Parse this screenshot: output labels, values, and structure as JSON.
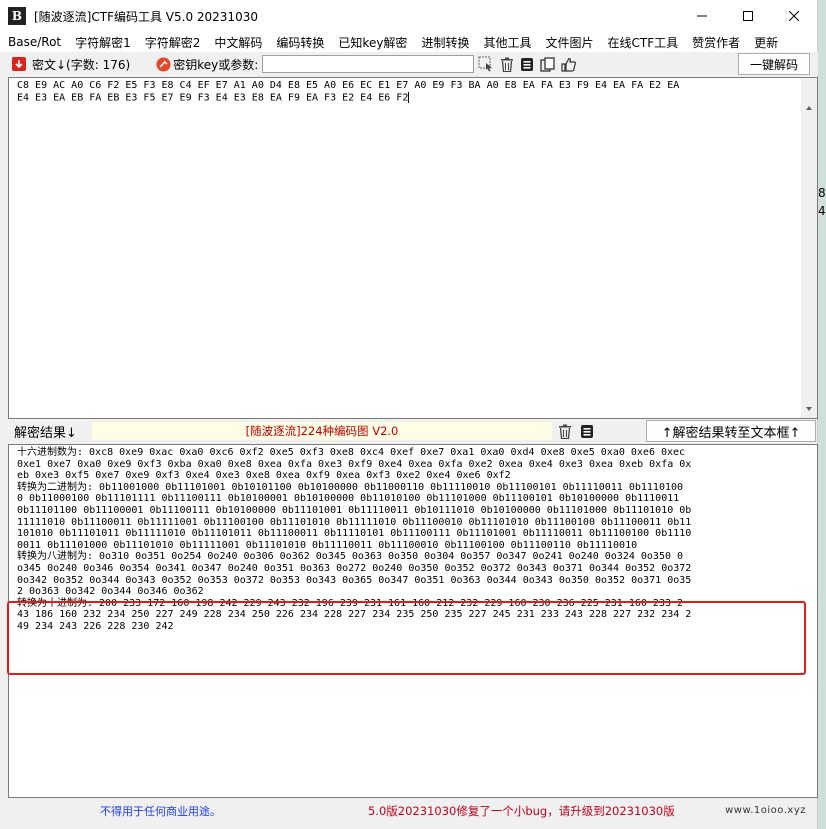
{
  "window": {
    "title": "[随波逐流]CTF编码工具 V5.0 20231030",
    "app_icon_letter": "B"
  },
  "menu": [
    "Base/Rot",
    "字符解密1",
    "字符解密2",
    "中文解码",
    "编码转换",
    "已知key解密",
    "进制转换",
    "其他工具",
    "文件图片",
    "在线CTF工具",
    "赞赏作者",
    "更新"
  ],
  "toolbar": {
    "cipher_label": "密文↓(字数: 176)",
    "key_label": "密钥key或参数:",
    "key_value": "",
    "one_click_label": "一键解码"
  },
  "input_lines": [
    "C8 E9 AC A0 C6 F2 E5 F3 E8 C4 EF E7 A1 A0 D4 E8 E5 A0 E6 EC E1 E7 A0 E9 F3 BA A0 E8 EA FA E3 F9 E4 EA FA E2 EA",
    "E4 E3 EA EB FA EB E3 F5 E7 E9 F3 E4 E3 E8 EA F9 EA F3 E2 E4 E6 F2"
  ],
  "result": {
    "label": "解密结果↓",
    "banner": "[随波逐流]224种编码图 V2.0",
    "transfer_label": "↑解密结果转至文本框↑",
    "lines": [
      "十六进制数为: 0xc8 0xe9 0xac 0xa0 0xc6 0xf2 0xe5 0xf3 0xe8 0xc4 0xef 0xe7 0xa1 0xa0 0xd4 0xe8 0xe5 0xa0 0xe6 0xec",
      "0xe1 0xe7 0xa0 0xe9 0xf3 0xba 0xa0 0xe8 0xea 0xfa 0xe3 0xf9 0xe4 0xea 0xfa 0xe2 0xea 0xe4 0xe3 0xea 0xeb 0xfa 0x",
      "eb 0xe3 0xf5 0xe7 0xe9 0xf3 0xe4 0xe3 0xe8 0xea 0xf9 0xea 0xf3 0xe2 0xe4 0xe6 0xf2",
      "转换为二进制为: 0b11001000 0b11101001 0b10101100 0b10100000 0b11000110 0b11110010 0b11100101 0b11110011 0b1110100",
      "0 0b11000100 0b11101111 0b11100111 0b10100001 0b10100000 0b11010100 0b11101000 0b11100101 0b10100000 0b1110011",
      "0b11101100 0b11100001 0b11100111 0b10100000 0b11101001 0b11110011 0b10111010 0b10100000 0b11101000 0b11101010 0b",
      "11111010 0b11100011 0b11111001 0b11100100 0b11101010 0b11111010 0b11100010 0b11101010 0b11100100 0b11100011 0b11",
      "101010 0b11101011 0b11111010 0b11101011 0b11100011 0b11110101 0b11100111 0b11101001 0b11110011 0b11100100 0b1110",
      "0011 0b11101000 0b11101010 0b11111001 0b11101010 0b11110011 0b11100010 0b11100100 0b11100110 0b11110010",
      "转换为八进制为: 0o310 0o351 0o254 0o240 0o306 0o362 0o345 0o363 0o350 0o304 0o357 0o347 0o241 0o240 0o324 0o350 0",
      "o345 0o240 0o346 0o354 0o341 0o347 0o240 0o351 0o363 0o272 0o240 0o350 0o352 0o372 0o343 0o371 0o344 0o352 0o372",
      "0o342 0o352 0o344 0o343 0o352 0o353 0o372 0o353 0o343 0o365 0o347 0o351 0o363 0o344 0o343 0o350 0o352 0o371 0o35",
      "2 0o363 0o342 0o344 0o346 0o362",
      "转换为十进制为: 200 233 172 160 198 242 229 243 232 196 239 231 161 160 212 232 229 160 230 236 225 231 160 233 2",
      "43 186 160 232 234 250 227 249 228 234 250 226 234 228 227 234 235 250 235 227 245 231 233 243 228 227 232 234 2",
      "49 234 243 226 228 230 242"
    ]
  },
  "status": {
    "left": "不得用于任何商业用途。",
    "right": "5.0版20231030修复了一个小bug，请升级到20231030版",
    "watermark": "www.1oioo.xyz"
  },
  "side_fragment": [
    "8",
    "4"
  ],
  "colors": {
    "accent_red": "#e21b1b",
    "status_blue": "#1e3cff",
    "status_red": "#c8001a",
    "banner_bg": "#fffde6"
  }
}
